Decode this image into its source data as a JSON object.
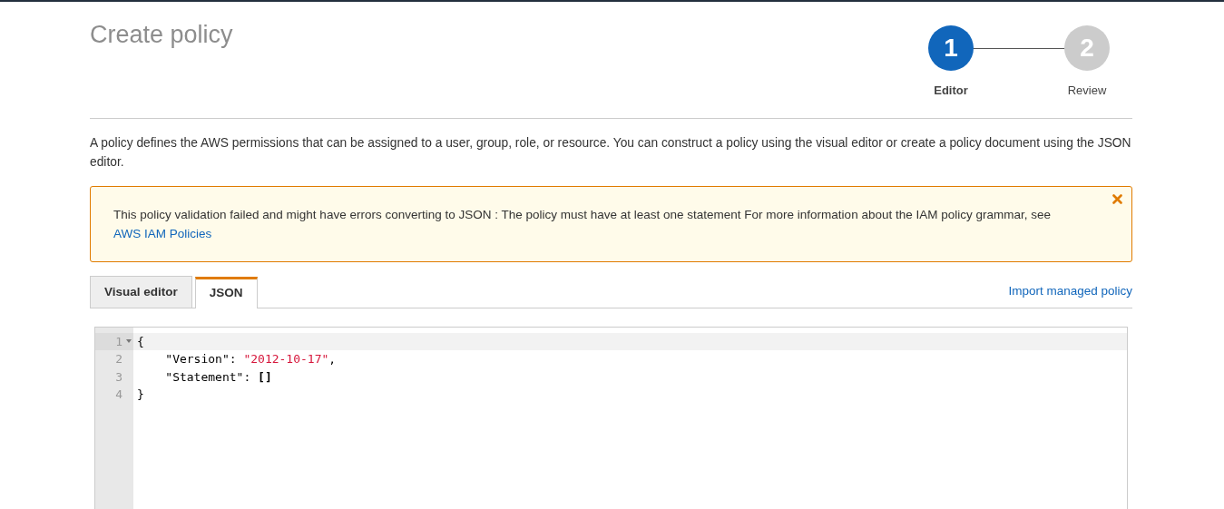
{
  "title": "Create policy",
  "steps": [
    {
      "number": "1",
      "label": "Editor",
      "selected": true
    },
    {
      "number": "2",
      "label": "Review",
      "selected": false
    }
  ],
  "description": "A policy defines the AWS permissions that can be assigned to a user, group, role, or resource. You can construct a policy using the visual editor or create a policy document using the JSON editor.",
  "alert": {
    "message": "This policy validation failed and might have errors converting to JSON : The policy must have at least one statement For more information about the IAM policy grammar, see",
    "link": "AWS IAM Policies"
  },
  "tabs": [
    {
      "label": "Visual editor",
      "selected": false
    },
    {
      "label": "JSON",
      "selected": true
    }
  ],
  "import_link": "Import managed policy",
  "editor": {
    "lines": [
      {
        "number": "1",
        "active": true,
        "foldable": true,
        "tokens": [
          {
            "kind": "punct",
            "text": "{"
          }
        ]
      },
      {
        "number": "2",
        "active": false,
        "foldable": false,
        "tokens": [
          {
            "kind": "key",
            "text": "    \"Version\""
          },
          {
            "kind": "punct",
            "text": ": "
          },
          {
            "kind": "string",
            "text": "\"2012-10-17\""
          },
          {
            "kind": "punct",
            "text": ","
          }
        ]
      },
      {
        "number": "3",
        "active": false,
        "foldable": false,
        "tokens": [
          {
            "kind": "key",
            "text": "    \"Statement\""
          },
          {
            "kind": "punct",
            "text": ": "
          },
          {
            "kind": "bracket",
            "text": "[]"
          }
        ]
      },
      {
        "number": "4",
        "active": false,
        "foldable": false,
        "tokens": [
          {
            "kind": "punct",
            "text": "}"
          }
        ]
      }
    ]
  }
}
